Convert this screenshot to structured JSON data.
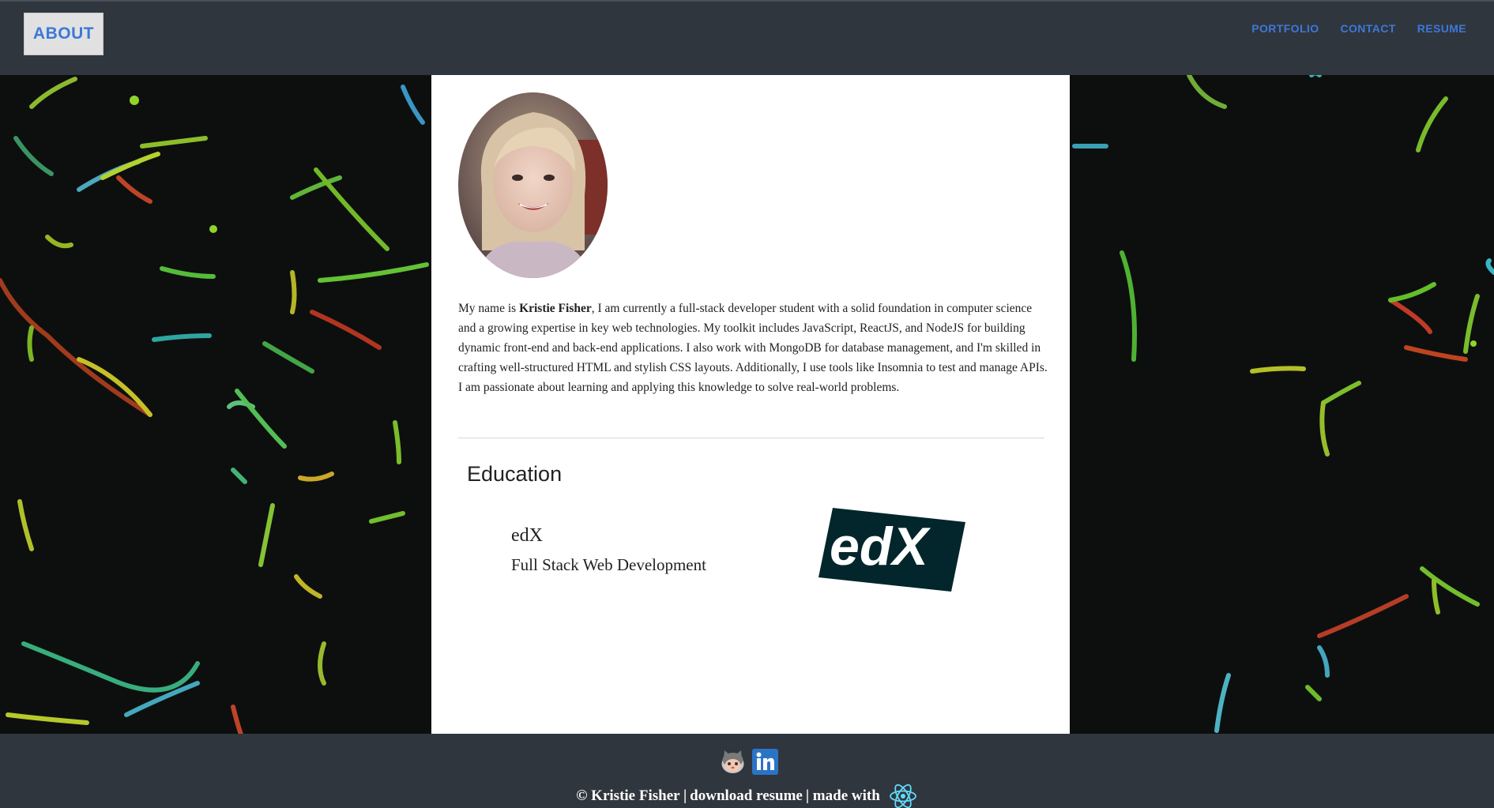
{
  "header": {
    "brand_label": "ABOUT",
    "nav": [
      "PORTFOLIO",
      "CONTACT",
      "RESUME"
    ]
  },
  "about": {
    "photo_icon": "profile-photo",
    "bio_prefix": "My name is ",
    "bio_name": "Kristie Fisher",
    "bio_rest": ", I am currently a full-stack developer student with a solid foundation in computer science and a growing expertise in key web technologies. My toolkit includes JavaScript, ReactJS, and NodeJS for building dynamic front-end and back-end applications. I also work with MongoDB for database management, and I'm skilled in crafting well-structured HTML and stylish CSS layouts. Additionally, I use tools like Insomnia to test and manage APIs. I am passionate about learning and applying this knowledge to solve real-world problems."
  },
  "education": {
    "heading": "Education",
    "school": "edX",
    "program": "Full Stack Web Development",
    "logo_text": "edX"
  },
  "footer": {
    "icons": [
      "github-icon",
      "linkedin-icon"
    ],
    "copyright": "© Kristie Fisher |",
    "download": "download resume",
    "made_with": " | made with",
    "tech_icon": "react-icon"
  },
  "colors": {
    "nav_bg": "#30363e",
    "link_blue": "#3c78d8",
    "edx_dark": "#02262b",
    "linkedin_blue": "#2a74c5"
  }
}
